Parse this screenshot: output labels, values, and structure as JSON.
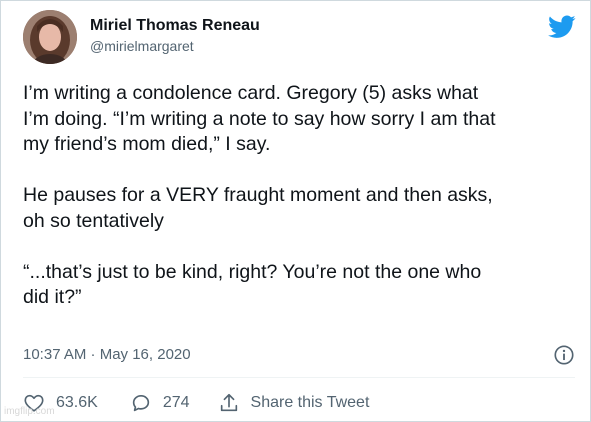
{
  "author": {
    "name": "Miriel Thomas Reneau",
    "handle": "@mirielmargaret",
    "avatar_icon": "profile-photo"
  },
  "tweet": {
    "paragraphs": [
      "I’m writing a condolence card. Gregory (5) asks what\nI’m doing. “I’m writing a note to say how sorry I am that\nmy friend’s mom died,” I say.",
      "He pauses for a VERY fraught moment and then asks,\noh so tentatively",
      "“...that’s just to be kind, right? You’re not the one who\ndid it?”"
    ]
  },
  "timestamp": "10:37 AM · May 16, 2020",
  "actions": {
    "likes": "63.6K",
    "replies": "274",
    "share_label": "Share this Tweet"
  },
  "watermark": "imgflip.com",
  "colors": {
    "twitter_blue": "#1d9bf0",
    "text": "#0f1419",
    "secondary": "#536471",
    "border": "#cfd9de"
  },
  "icons": [
    "twitter-bird-icon",
    "info-icon",
    "heart-icon",
    "reply-icon",
    "share-icon"
  ]
}
